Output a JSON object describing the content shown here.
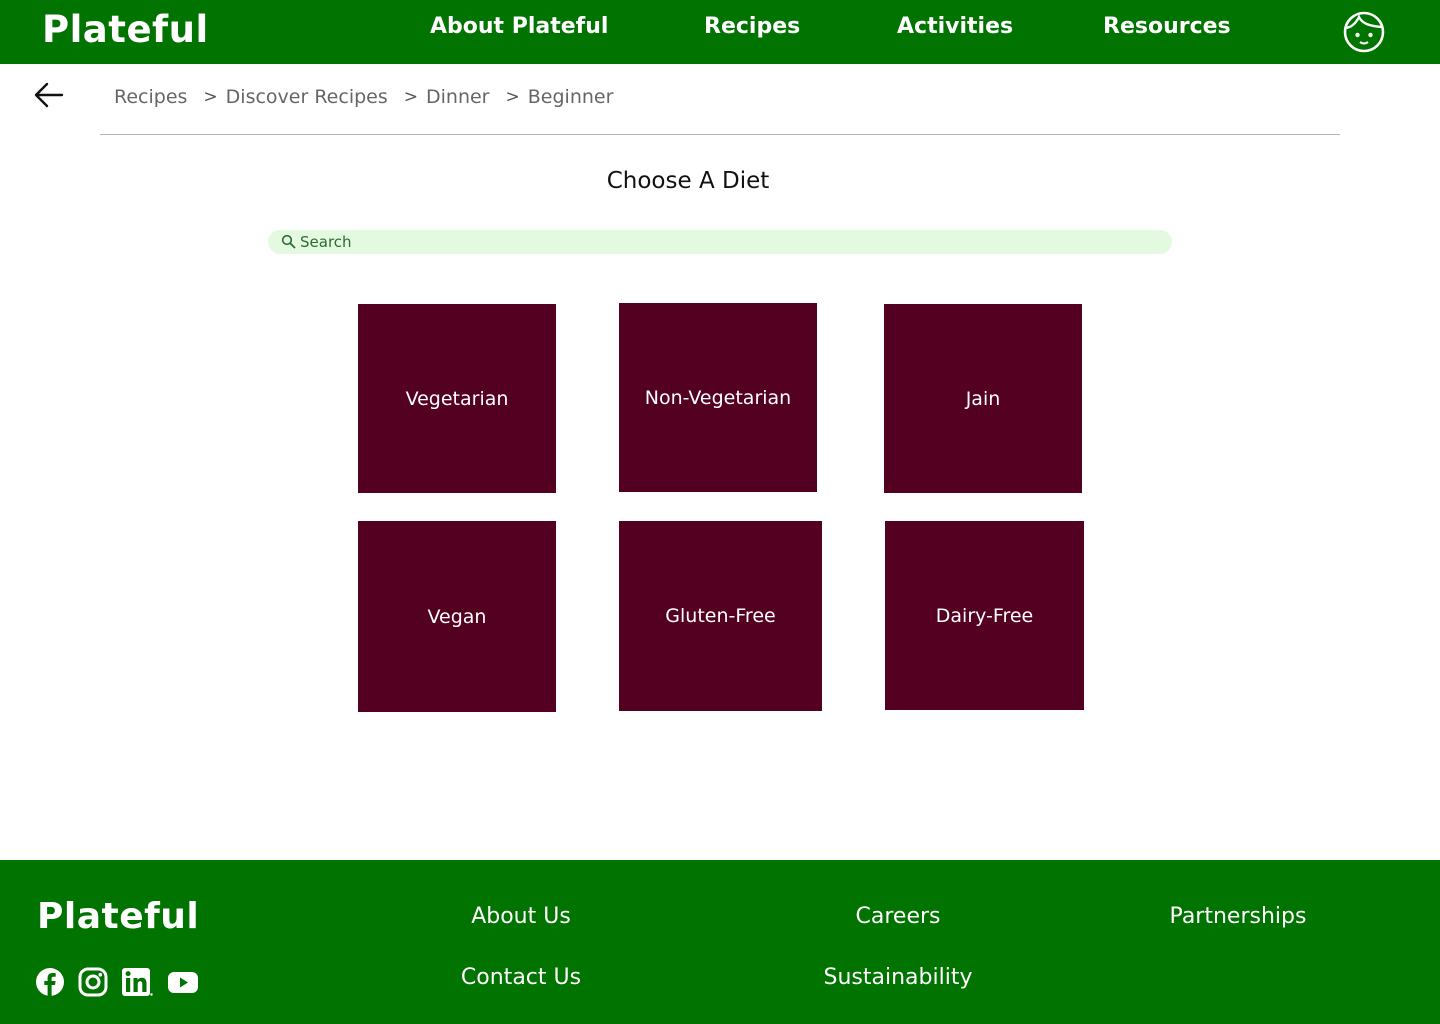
{
  "header": {
    "logo": "Plateful",
    "nav": [
      {
        "label": "About Plateful"
      },
      {
        "label": "Recipes"
      },
      {
        "label": "Activities"
      },
      {
        "label": "Resources"
      }
    ],
    "profile_icon": "profile-face-icon",
    "background_color": "#007300"
  },
  "breadcrumb": {
    "back_icon": "arrow-left-icon",
    "separator": ">",
    "items": [
      "Recipes",
      "Discover Recipes",
      "Dinner",
      "Beginner"
    ]
  },
  "main": {
    "title": "Choose A Diet",
    "search": {
      "placeholder": "Search",
      "value": "",
      "icon": "search-icon",
      "background_color": "#e3fae0"
    },
    "card_color": "#540020",
    "diets": [
      {
        "label": "Vegetarian"
      },
      {
        "label": "Non-Vegetarian"
      },
      {
        "label": "Jain"
      },
      {
        "label": "Vegan"
      },
      {
        "label": "Gluten-Free"
      },
      {
        "label": "Dairy-Free"
      }
    ]
  },
  "footer": {
    "logo": "Plateful",
    "links": [
      {
        "label": "About Us"
      },
      {
        "label": "Careers"
      },
      {
        "label": "Partnerships"
      },
      {
        "label": "Contact Us"
      },
      {
        "label": "Sustainability"
      }
    ],
    "social": [
      "facebook-icon",
      "instagram-icon",
      "linkedin-icon",
      "youtube-icon"
    ]
  }
}
